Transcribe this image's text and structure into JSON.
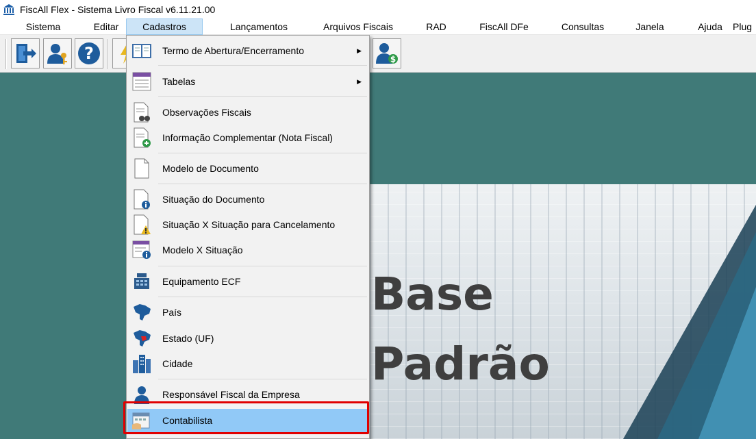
{
  "window": {
    "title": "FiscAll Flex - Sistema Livro Fiscal v6.11.21.00",
    "app_icon": "building-columns-icon"
  },
  "menubar": [
    {
      "label": "Sistema"
    },
    {
      "label": "Editar"
    },
    {
      "label": "Cadastros",
      "active": true
    },
    {
      "label": "Lançamentos"
    },
    {
      "label": "Arquivos Fiscais"
    },
    {
      "label": "RAD"
    },
    {
      "label": "FiscAll DFe"
    },
    {
      "label": "Consultas"
    },
    {
      "label": "Janela"
    },
    {
      "label": "Ajuda"
    },
    {
      "label": "Plug"
    }
  ],
  "toolbar": {
    "buttons": [
      "exit-door-icon",
      "user-key-icon",
      "help-question-icon",
      "lightning-icon",
      "user-money-icon"
    ]
  },
  "dropdown": {
    "items": [
      {
        "label": "Termo de Abertura/Encerramento",
        "icon": "open-book-icon",
        "submenu": true
      },
      {
        "label": "Tabelas",
        "icon": "table-list-icon",
        "submenu": true
      },
      {
        "label": "Observações Fiscais",
        "icon": "document-binoculars-icon"
      },
      {
        "label": "Informação Complementar (Nota Fiscal)",
        "icon": "document-add-icon"
      },
      {
        "label": "Modelo de Documento",
        "icon": "blank-document-icon"
      },
      {
        "label": "Situação do Documento",
        "icon": "document-info-icon"
      },
      {
        "label": "Situação X Situação para Cancelamento",
        "icon": "document-warning-icon"
      },
      {
        "label": "Modelo X Situação",
        "icon": "table-info-icon"
      },
      {
        "label": "Equipamento ECF",
        "icon": "cash-register-icon"
      },
      {
        "label": "País",
        "icon": "country-map-icon"
      },
      {
        "label": "Estado (UF)",
        "icon": "state-map-icon"
      },
      {
        "label": "Cidade",
        "icon": "city-buildings-icon"
      },
      {
        "label": "Responsável Fiscal da Empresa",
        "icon": "person-icon"
      },
      {
        "label": "Contabilista",
        "icon": "calculator-hand-icon",
        "highlighted": true
      }
    ]
  },
  "banner": {
    "line1": "Base",
    "line2": "Padrão"
  },
  "colors": {
    "workspace": "#407a78",
    "highlight": "#91c9f7",
    "annotation_box": "#e00000",
    "menu_active": "#cce4f7"
  }
}
